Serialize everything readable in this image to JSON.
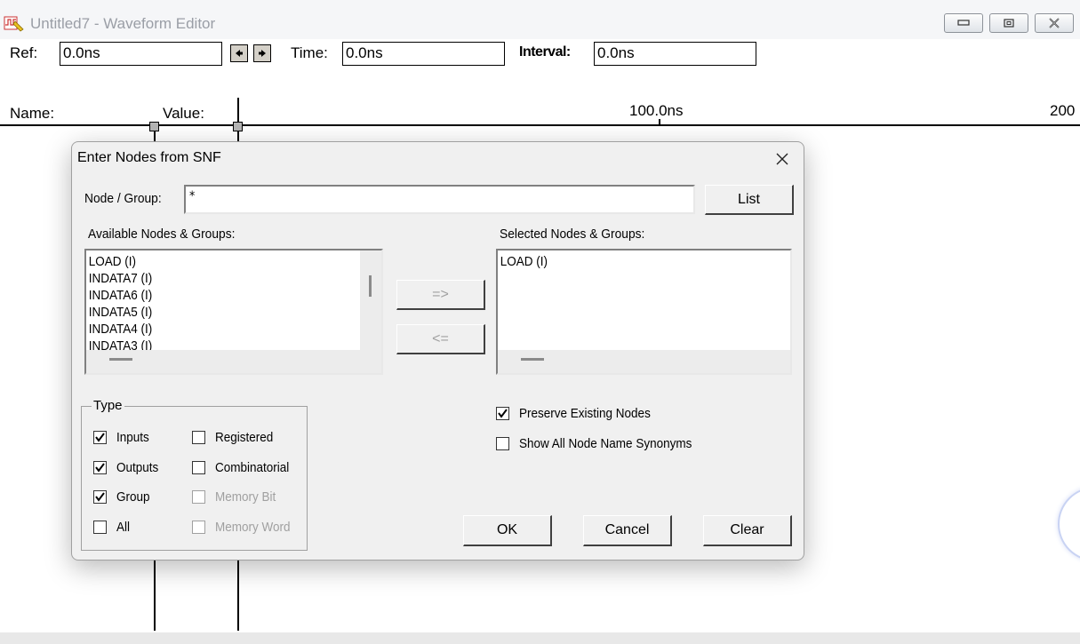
{
  "window": {
    "title": "Untitled7 - Waveform Editor"
  },
  "toolbar": {
    "ref_label": "Ref:",
    "ref_value": "0.0ns",
    "time_label": "Time:",
    "time_value": "0.0ns",
    "interval_label": "Interval:",
    "interval_value": "0.0ns"
  },
  "columns": {
    "name_label": "Name:",
    "value_label": "Value:",
    "tick_100": "100.0ns",
    "tick_200": "200"
  },
  "dialog": {
    "title": "Enter Nodes from SNF",
    "node_group_label": "Node / Group:",
    "node_group_value": "*",
    "list_button": "List",
    "available_label": "Available Nodes & Groups:",
    "available_items": [
      "LOAD (I)",
      "INDATA7 (I)",
      "INDATA6 (I)",
      "INDATA5 (I)",
      "INDATA4 (I)",
      "INDATA3 (I)"
    ],
    "selected_label": "Selected Nodes & Groups:",
    "selected_items": [
      "LOAD (I)"
    ],
    "add_button": "=>",
    "remove_button": "<=",
    "type_group_label": "Type",
    "type_options": {
      "inputs": {
        "label": "Inputs",
        "checked": true
      },
      "outputs": {
        "label": "Outputs",
        "checked": true
      },
      "group": {
        "label": "Group",
        "checked": true
      },
      "all": {
        "label": "All",
        "checked": false
      },
      "registered": {
        "label": "Registered",
        "checked": false
      },
      "combinatorial": {
        "label": "Combinatorial",
        "checked": false
      },
      "memory_bit": {
        "label": "Memory Bit",
        "checked": false
      },
      "memory_word": {
        "label": "Memory Word",
        "checked": false
      }
    },
    "preserve_label": "Preserve Existing Nodes",
    "preserve_checked": true,
    "synonyms_label": "Show All Node Name Synonyms",
    "synonyms_checked": false,
    "ok_button": "OK",
    "cancel_button": "Cancel",
    "clear_button": "Clear"
  }
}
